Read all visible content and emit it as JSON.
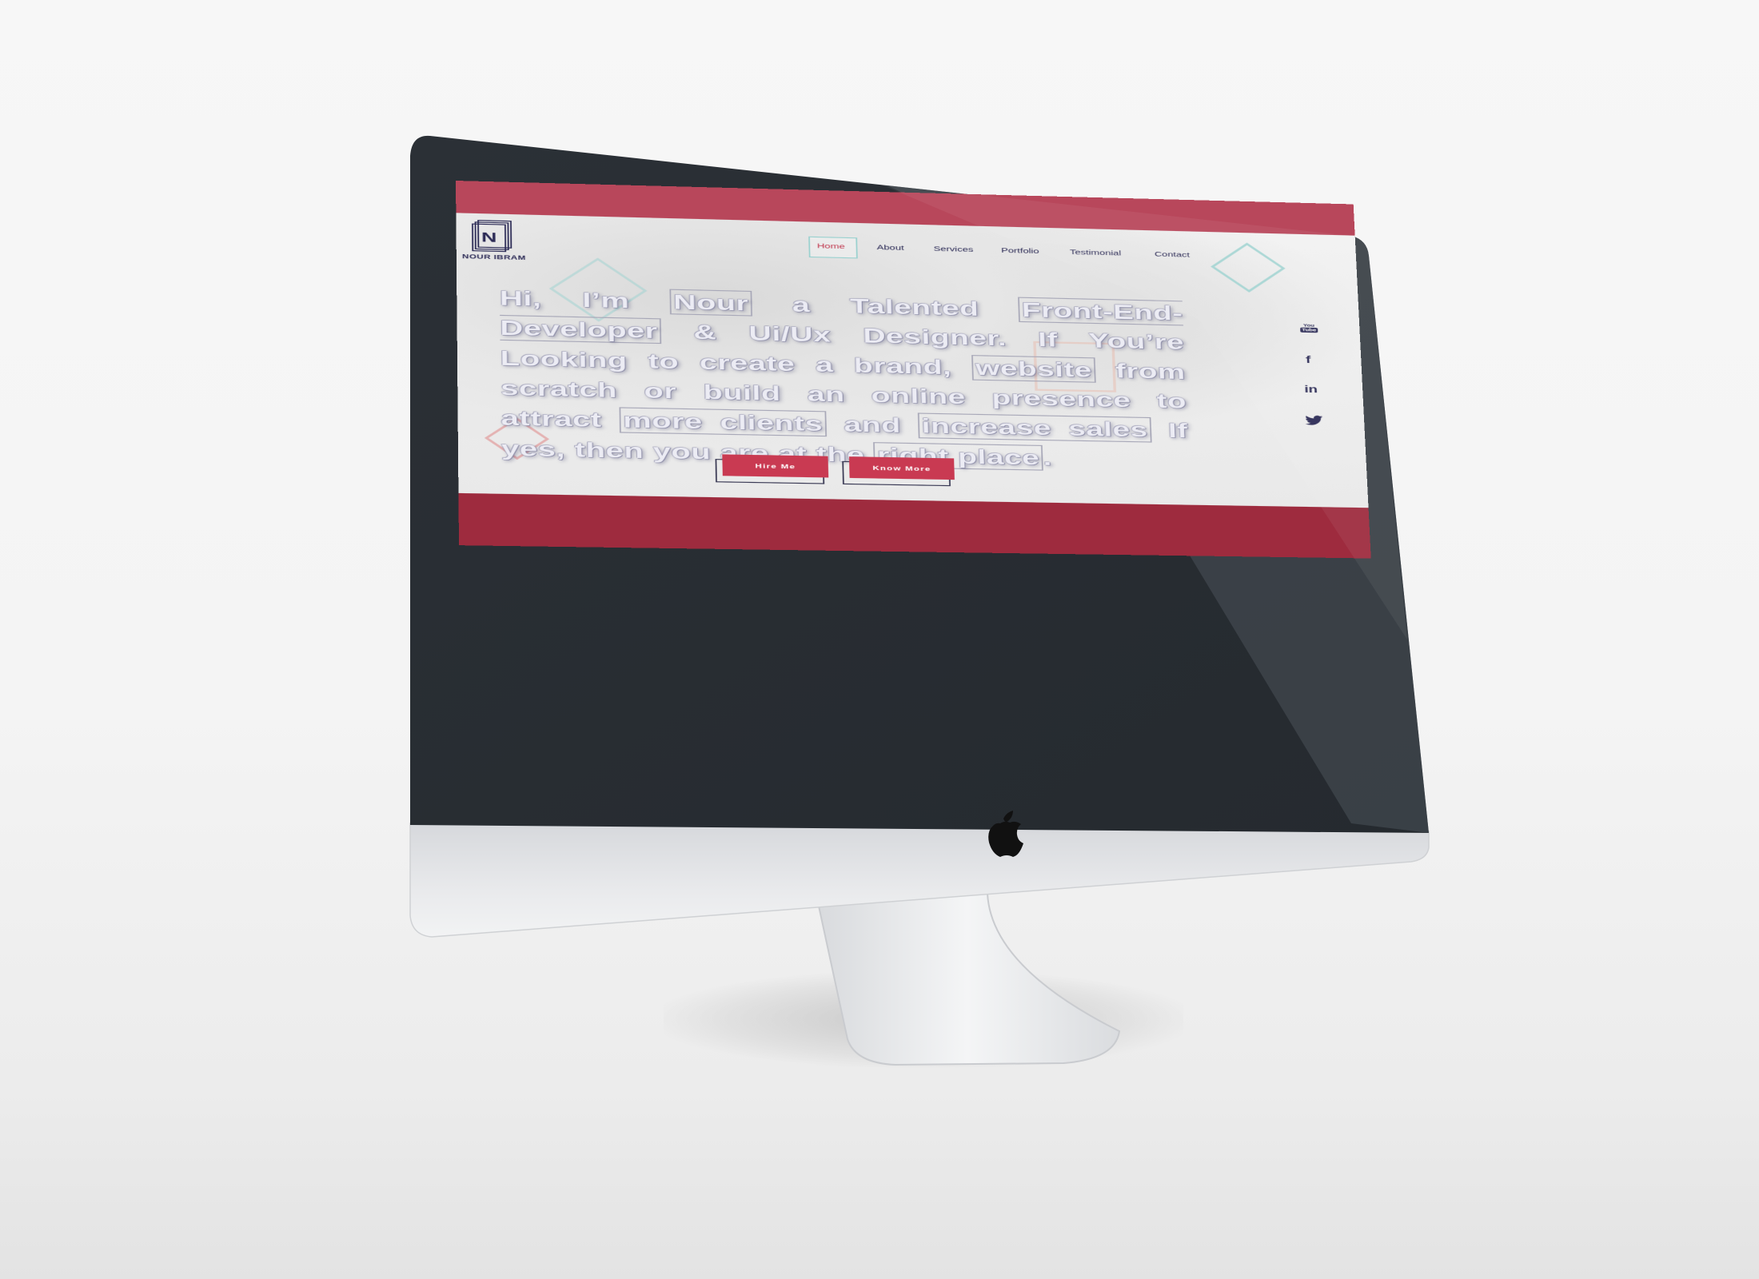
{
  "brand": {
    "logo_letter": "N",
    "name": "NOUR IBRAM"
  },
  "nav": {
    "items": [
      {
        "label": "Home",
        "active": true
      },
      {
        "label": "About"
      },
      {
        "label": "Services"
      },
      {
        "label": "Portfolio"
      },
      {
        "label": "Testimonial"
      },
      {
        "label": "Contact"
      }
    ]
  },
  "hero": {
    "segments": [
      {
        "text": "Hi, I’m ",
        "highlight": false
      },
      {
        "text": "Nour",
        "highlight": true
      },
      {
        "text": " a Talented ",
        "highlight": false
      },
      {
        "text": "Front-End-Developer",
        "highlight": true
      },
      {
        "text": " & Ui/Ux Designer. If You’re Looking to create a brand, ",
        "highlight": false
      },
      {
        "text": "website",
        "highlight": true
      },
      {
        "text": " from scratch or build an online presence to attract ",
        "highlight": false
      },
      {
        "text": "more clients",
        "highlight": true
      },
      {
        "text": " and ",
        "highlight": false
      },
      {
        "text": "increase sales",
        "highlight": true
      },
      {
        "text": " If yes, then you are at the ",
        "highlight": false
      },
      {
        "text": "right place",
        "highlight": true
      },
      {
        "text": ".",
        "highlight": false
      }
    ]
  },
  "buttons": {
    "hire": "Hire Me",
    "know_more": "Know More"
  },
  "social": {
    "youtube": {
      "label": "You Tube",
      "icon": "youtube-icon"
    },
    "facebook": {
      "label": "f",
      "icon": "facebook-icon"
    },
    "linkedin": {
      "label": "in",
      "icon": "linkedin-icon"
    },
    "twitter": {
      "icon": "twitter-icon"
    }
  },
  "colors": {
    "accent": "#c93a52",
    "frame_red": "#b8475b",
    "navy": "#2b2a55",
    "teal": "#9ad1cf"
  }
}
